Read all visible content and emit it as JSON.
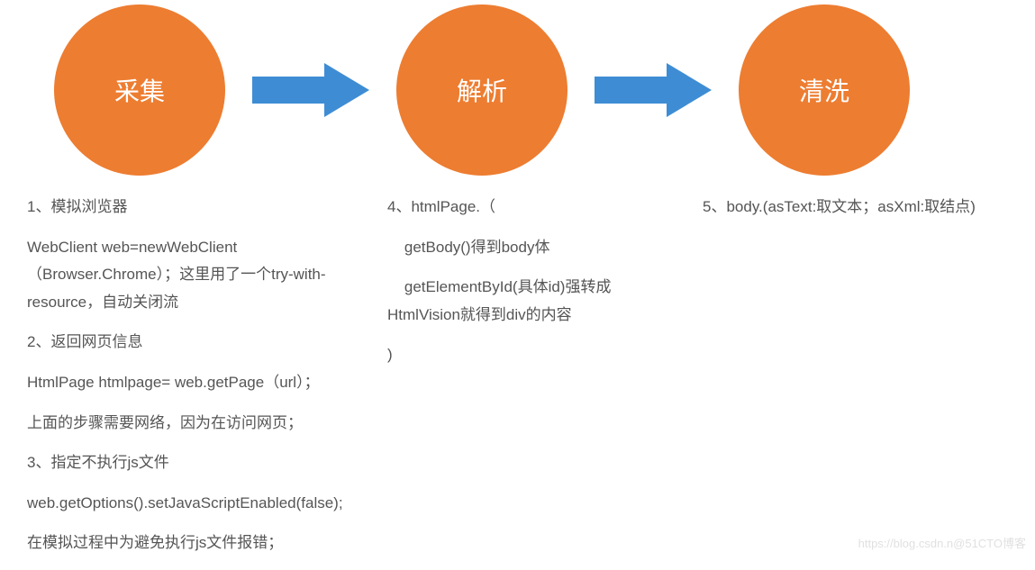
{
  "steps": {
    "step1": {
      "label": "采集"
    },
    "step2": {
      "label": "解析"
    },
    "step3": {
      "label": "清洗"
    }
  },
  "col1": {
    "p1": "1、模拟浏览器",
    "p2": "WebClient web=newWebClient（Browser.Chrome）；这里用了一个try-with-resource，自动关闭流",
    "p3": "2、返回网页信息",
    "p4": "HtmlPage htmlpage= web.getPage（url）；",
    "p5": "上面的步骤需要网络，因为在访问网页；",
    "p6": "3、指定不执行js文件",
    "p7": "web.getOptions().setJavaScriptEnabled(false);",
    "p8": "在模拟过程中为避免执行js文件报错；"
  },
  "col2": {
    "p1": "4、htmlPage.（",
    "p2": "    getBody()得到body体",
    "p3": "    getElementById(具体id)强转成HtmlVision就得到div的内容",
    "p4": ")"
  },
  "col3": {
    "p1": "5、body.(asText:取文本；asXml:取结点)"
  },
  "watermark": "https://blog.csdn.n@51CTO博客"
}
